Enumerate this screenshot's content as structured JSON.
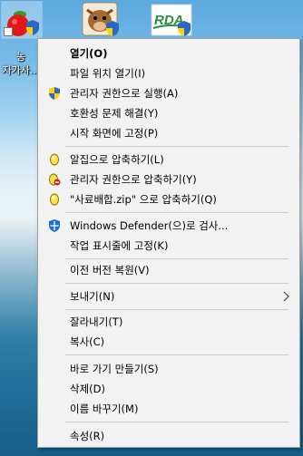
{
  "desktop": {
    "icons": [
      {
        "name": "apple-app",
        "label": "농\n자가사..."
      },
      {
        "name": "cow-app",
        "label": ""
      },
      {
        "name": "rda-app",
        "label": ""
      }
    ]
  },
  "context_menu": {
    "items": {
      "open": "열기(O)",
      "open_location": "파일 위치 열기(I)",
      "run_as_admin": "관리자 권한으로 실행(A)",
      "troubleshoot_compat": "호환성 문제 해결(Y)",
      "pin_to_start": "시작 화면에 고정(P)",
      "compress_alzip": "알집으로 압축하기(L)",
      "compress_admin": "관리자 권한으로 압축하기(Y)",
      "compress_zip": "\"사료배합.zip\" 으로 압축하기(Q)",
      "defender_scan": "Windows Defender(으)로 검사...",
      "pin_to_taskbar": "작업 표시줄에 고정(K)",
      "restore_previous": "이전 버전 복원(V)",
      "send_to": "보내기(N)",
      "cut": "잘라내기(T)",
      "copy": "복사(C)",
      "create_shortcut": "바로 가기 만들기(S)",
      "delete": "삭제(D)",
      "rename": "이름 바꾸기(M)",
      "properties": "속성(R)"
    }
  }
}
